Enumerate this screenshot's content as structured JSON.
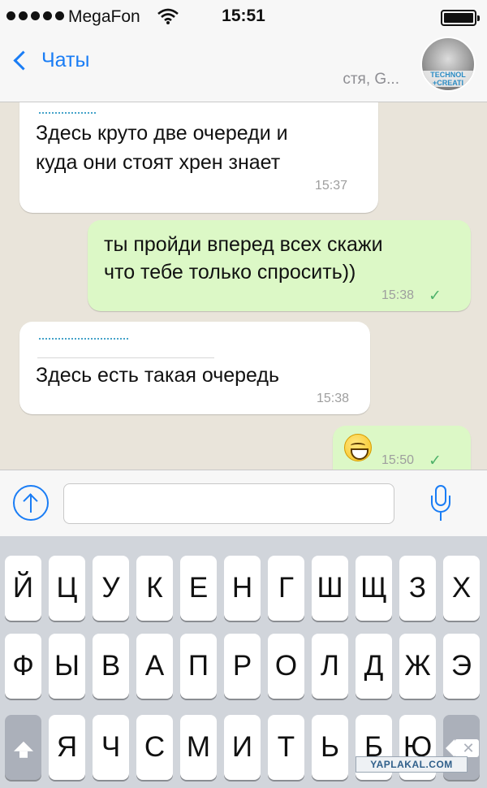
{
  "status_bar": {
    "carrier": "MegaFon",
    "time": "15:51",
    "signal_bars_filled": 5,
    "battery_level": 1.0
  },
  "nav": {
    "back_label": "Чаты",
    "subtitle": "стя, G...",
    "avatar_text": "TECHNOL +CREATI"
  },
  "messages": [
    {
      "direction": "in",
      "text_lines": [
        "Здесь круто две очереди и",
        "куда они стоят хрен знает"
      ],
      "time": "15:37"
    },
    {
      "direction": "out",
      "text_lines": [
        "ты пройди вперед всех скажи",
        "что тебе только спросить))"
      ],
      "time": "15:38",
      "status": "✓"
    },
    {
      "direction": "in",
      "text_lines": [
        "Здесь есть такая очередь"
      ],
      "time": "15:38"
    },
    {
      "direction": "out",
      "emoji": "grinning-face",
      "time": "15:50",
      "status": "✓"
    }
  ],
  "input": {
    "value": "",
    "placeholder": ""
  },
  "keyboard": {
    "rows": [
      [
        "Й",
        "Ц",
        "У",
        "К",
        "Е",
        "Н",
        "Г",
        "Ш",
        "Щ",
        "З",
        "Х"
      ],
      [
        "Ф",
        "Ы",
        "В",
        "А",
        "П",
        "Р",
        "О",
        "Л",
        "Д",
        "Ж",
        "Э"
      ],
      [
        "Я",
        "Ч",
        "С",
        "М",
        "И",
        "Т",
        "Ь",
        "Б",
        "Ю"
      ]
    ]
  },
  "watermark": "YAPLAKAL.COM",
  "colors": {
    "accent": "#1a7df5",
    "outgoing_bubble": "#dcf8c6",
    "incoming_bubble": "#ffffff",
    "chat_background": "#e9e4da",
    "read_check": "#4fb26a"
  }
}
